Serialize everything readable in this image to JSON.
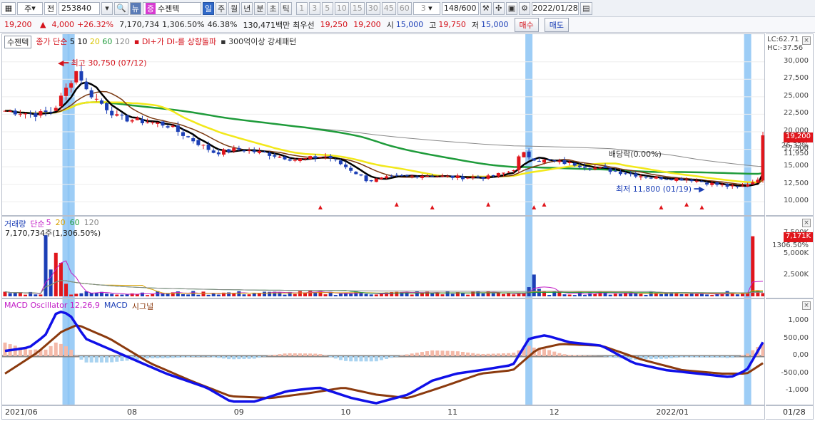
{
  "toolbar": {
    "period_select": "주",
    "prev_label": "전",
    "code": "253840",
    "stock_name": "수젠텍",
    "periods": [
      "일",
      "주",
      "월",
      "년",
      "분",
      "초",
      "틱"
    ],
    "active_period": "일",
    "nums": [
      "1",
      "3",
      "5",
      "10",
      "15",
      "30",
      "45",
      "60"
    ],
    "count_select": "3",
    "page_count": "148/600",
    "date": "2022/01/28"
  },
  "info": {
    "price": "19,200",
    "change": "4,000",
    "change_pct": "+26.32%",
    "volume": "7,170,734",
    "vol_pct": "1,306.50%",
    "ratio": "46.38%",
    "amount": "130,471백만",
    "priority_label": "최우선",
    "ask": "19,250",
    "bid": "19,200",
    "open_label": "시",
    "open": "15,000",
    "high_label": "고",
    "high": "19,750",
    "low_label": "저",
    "low": "15,000",
    "buy_label": "매수",
    "sell_label": "매도"
  },
  "price_panel": {
    "title": "수젠텍",
    "legend_ma": "종가 단순",
    "ma_periods": [
      "5",
      "10",
      "20",
      "60",
      "120"
    ],
    "legend_signal": "DI+가 DI-를 상향돌파",
    "legend_pattern": "300억이상 강세패턴",
    "lc": "LC:62.71",
    "hc": "HC:-37.56",
    "last_price": "19,200",
    "last_pct": "26.32%",
    "prev_price_tag": "11,950",
    "high_annot": "최고 30,750 (07/12)",
    "low_annot": "최저 11,800 (01/19)",
    "dividend_annot": "배당락(0.00%)",
    "ticks": [
      "30,000",
      "27,500",
      "25,000",
      "22,500",
      "20,000",
      "17,500",
      "15,000",
      "12,500",
      "10,000"
    ]
  },
  "volume_panel": {
    "title": "거래량",
    "legend_ma": "단순",
    "ma_periods": [
      "5",
      "20",
      "60",
      "120"
    ],
    "volume_text": "7,170,734주(1,306.50%)",
    "last_tag": "7,171K",
    "last_pct": "1306.50%",
    "top_tick": "7,500K",
    "ticks": [
      "5,000K",
      "2,500K"
    ]
  },
  "macd_panel": {
    "title": "MACD Oscillator 12,26,9",
    "macd_label": "MACD",
    "signal_label": "시그널",
    "ticks": [
      "1,000",
      "500,00",
      "0,00",
      "-500,00",
      "-1,000"
    ]
  },
  "xaxis": {
    "labels": [
      "2021/06",
      "08",
      "09",
      "10",
      "11",
      "12",
      "2022/01"
    ],
    "right": "01/28"
  },
  "colors": {
    "up": "#e0161c",
    "down": "#1c3fb6",
    "ma5": "#000000",
    "ma10": "#7b3a12",
    "ma20": "#f2e81a",
    "ma60": "#1e9b3a",
    "ma120": "#888888",
    "highlight": "#8cc4f5"
  }
}
